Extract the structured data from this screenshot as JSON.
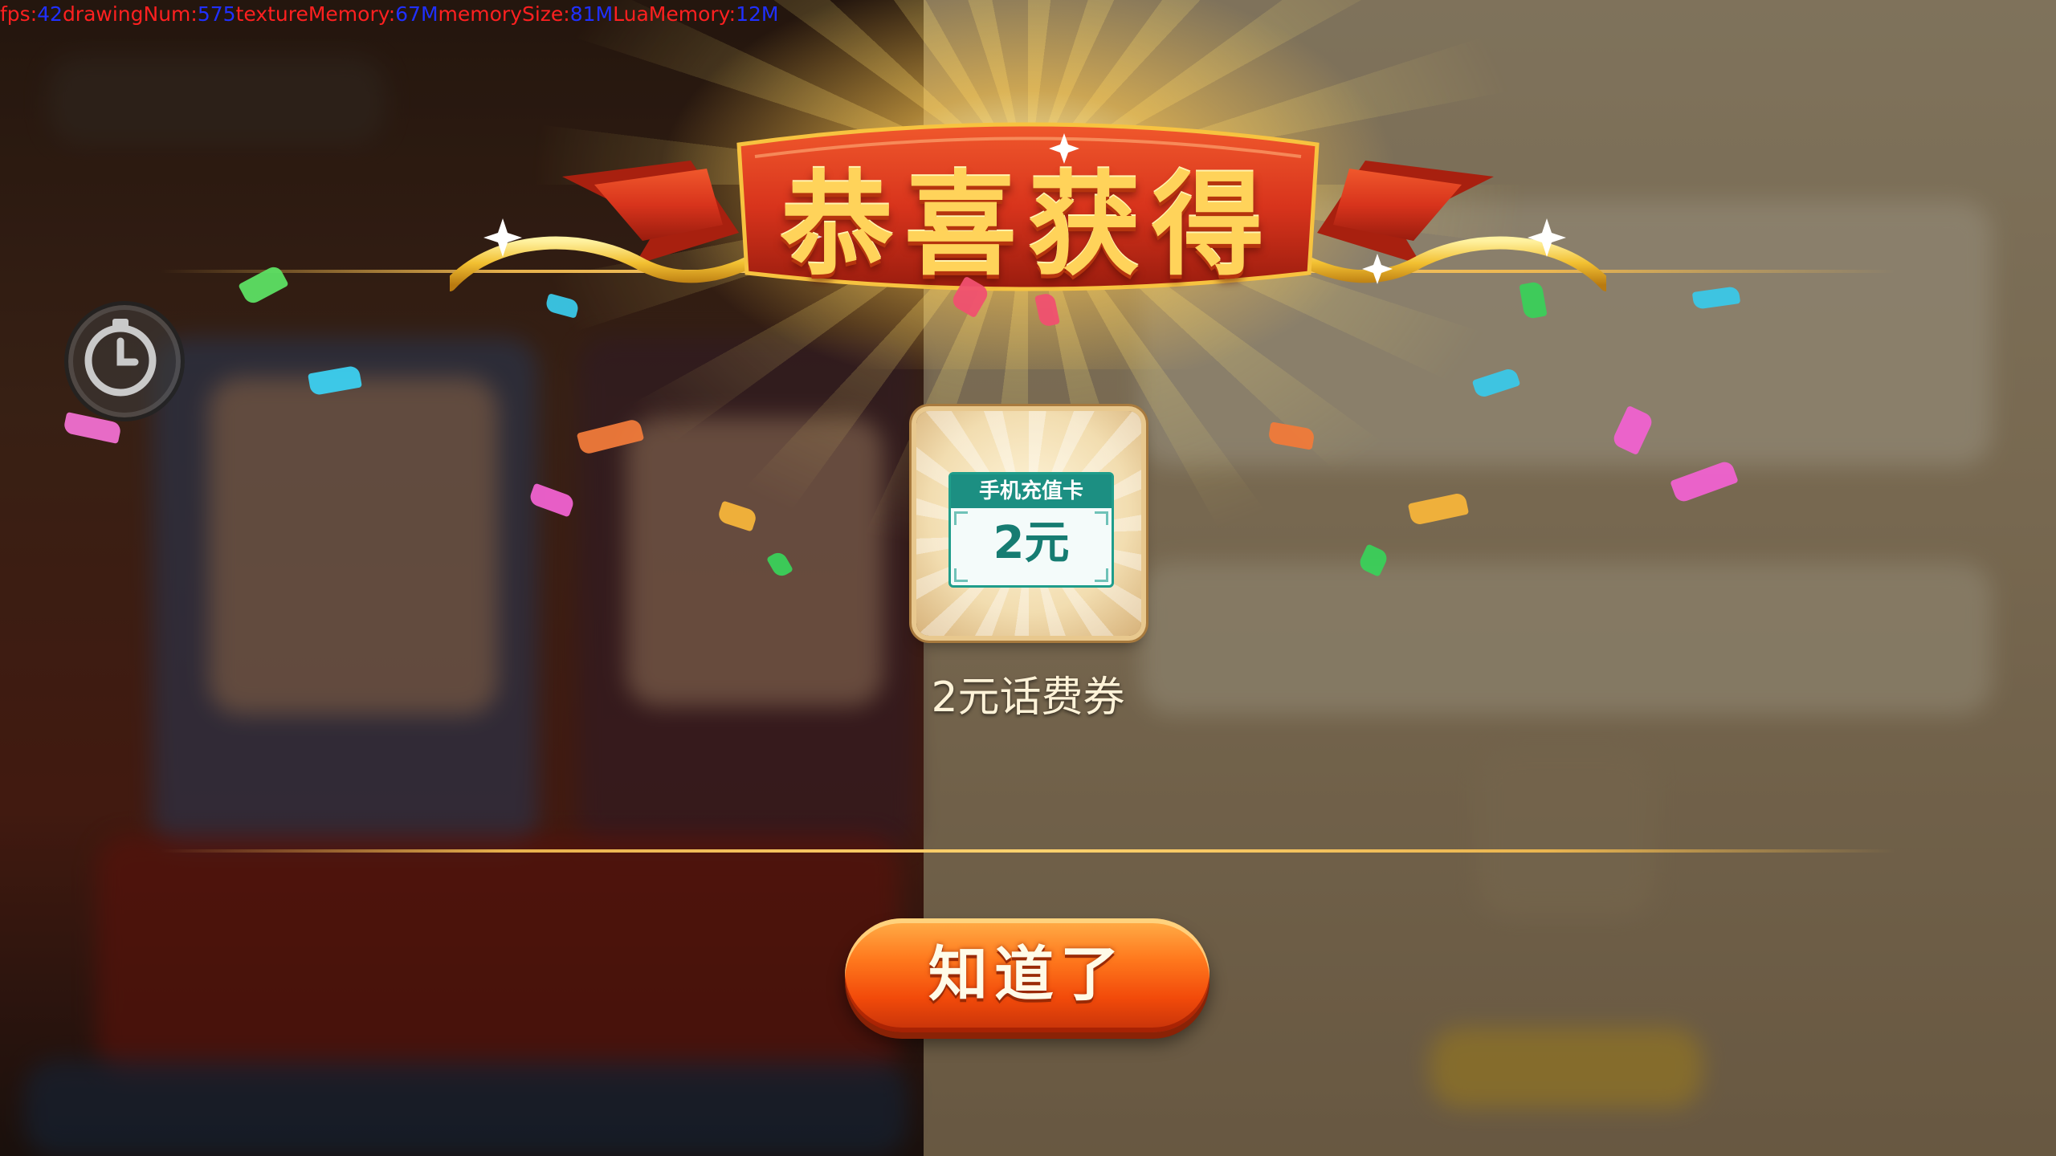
{
  "debug": {
    "fps_label": "fps:",
    "fps_value": "42",
    "drawing_label": "drawingNum:",
    "drawing_value": "575",
    "texture_label": "textureMemory:",
    "texture_value": "67M",
    "memory_label": "memorySize:",
    "memory_value": "81M",
    "lua_label": "LuaMemory:",
    "lua_value": "12M"
  },
  "popup": {
    "title": "恭喜获得",
    "reward": {
      "card_header": "手机充值卡",
      "card_value": "2元",
      "name": "2元话费券"
    },
    "confirm_label": "知道了"
  },
  "colors": {
    "title_gold": "#ffd35a",
    "ribbon_red": "#d8341c",
    "button_orange": "#ff7a1e",
    "coupon_teal": "#1c8f82",
    "debug_key": "#ff2020",
    "debug_value": "#2030ff"
  },
  "icons": {
    "timer": "stopwatch-icon"
  }
}
